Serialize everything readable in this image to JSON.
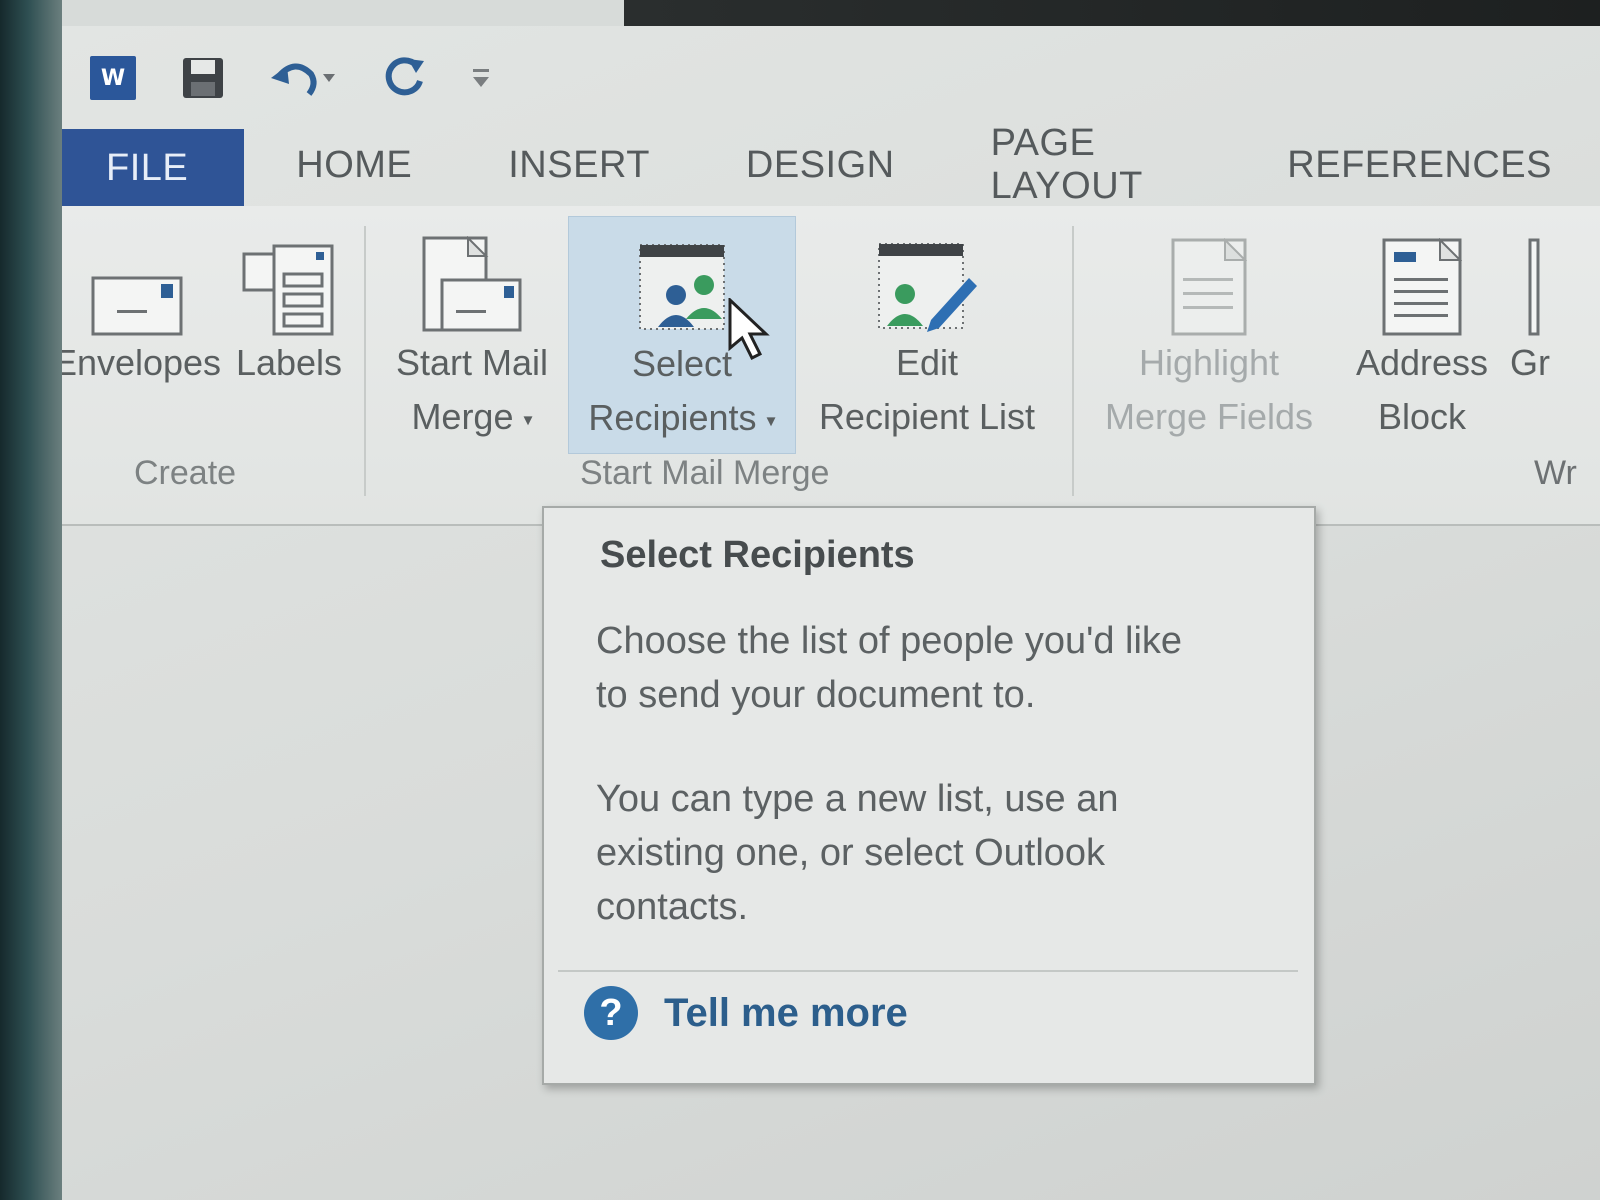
{
  "quick_access": {
    "word_logo": "W",
    "items": [
      "word-icon",
      "save-icon",
      "undo-icon",
      "redo-icon",
      "customize-icon"
    ]
  },
  "tabs": [
    {
      "label": "FILE"
    },
    {
      "label": "HOME"
    },
    {
      "label": "INSERT"
    },
    {
      "label": "DESIGN"
    },
    {
      "label": "PAGE LAYOUT"
    },
    {
      "label": "REFERENCES"
    }
  ],
  "ribbon": {
    "create": {
      "label": "Create",
      "envelopes": "Envelopes",
      "labels": "Labels"
    },
    "start_mail_merge": {
      "label": "Start Mail Merge",
      "start_line1": "Start Mail",
      "start_line2": "Merge",
      "select_line1": "Select",
      "select_line2": "Recipients",
      "edit_line1": "Edit",
      "edit_line2": "Recipient List"
    },
    "write_insert": {
      "label": "Wr",
      "highlight_line1": "Highlight",
      "highlight_line2": "Merge Fields",
      "address_line1": "Address",
      "address_line2": "Block",
      "greeting_line1": "Gr"
    }
  },
  "tooltip": {
    "title": "Select Recipients",
    "p1_line1": "Choose the list of people you'd like",
    "p1_line2": "to send your document to.",
    "p2_line1": "You can type a new list, use an",
    "p2_line2": "existing one, or select Outlook",
    "p2_line3": "contacts.",
    "help_label": "Tell me more",
    "help_glyph": "?"
  },
  "colors": {
    "file_tab": "#2f5496",
    "selected_button": "#c9dbe8",
    "help_accent": "#2f6fa8"
  }
}
